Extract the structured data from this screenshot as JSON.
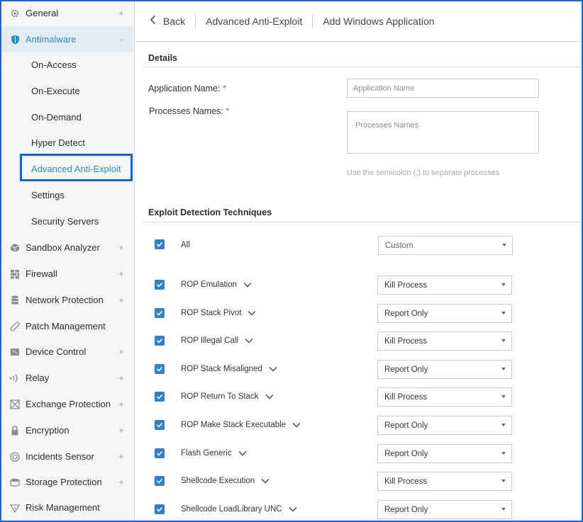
{
  "sidebar": {
    "items": [
      {
        "label": "General",
        "icon": "gear-icon",
        "expander": "+"
      },
      {
        "label": "Antimalware",
        "icon": "shield-icon",
        "expander": "-"
      },
      {
        "label": "Sandbox Analyzer",
        "icon": "cube-icon",
        "expander": "+"
      },
      {
        "label": "Firewall",
        "icon": "brick-wall-icon",
        "expander": "+"
      },
      {
        "label": "Network Protection",
        "icon": "database-icon",
        "expander": "+"
      },
      {
        "label": "Patch Management",
        "icon": "bandage-icon",
        "expander": ""
      },
      {
        "label": "Device Control",
        "icon": "device-icon",
        "expander": "+"
      },
      {
        "label": "Relay",
        "icon": "relay-icon",
        "expander": "+"
      },
      {
        "label": "Exchange Protection",
        "icon": "exchange-icon",
        "expander": "+"
      },
      {
        "label": "Encryption",
        "icon": "lock-icon",
        "expander": "+"
      },
      {
        "label": "Incidents Sensor",
        "icon": "sensor-icon",
        "expander": "+"
      },
      {
        "label": "Storage Protection",
        "icon": "storage-icon",
        "expander": "+"
      },
      {
        "label": "Risk Management",
        "icon": "risk-icon",
        "expander": ""
      }
    ],
    "antimalware_sub": [
      "On-Access",
      "On-Execute",
      "On-Demand",
      "Hyper Detect",
      "Advanced Anti-Exploit",
      "Settings",
      "Security Servers"
    ]
  },
  "topbar": {
    "back_label": "Back",
    "crumbs": [
      "Advanced Anti-Exploit",
      "Add Windows Application"
    ]
  },
  "details": {
    "title": "Details",
    "app_name_label": "Application Name:",
    "app_name_placeholder": "Application Name",
    "processes_label": "Processes Names:",
    "processes_placeholder": "Processes Names",
    "required_mark": "*",
    "hint": "Use the semicolon (;) to separate processes"
  },
  "exploit": {
    "title": "Exploit Detection Techniques",
    "all_label": "All",
    "all_value": "Custom",
    "techniques": [
      {
        "label": "ROP Emulation",
        "action": "Kill Process",
        "checked": true
      },
      {
        "label": "ROP Stack Pivot",
        "action": "Report Only",
        "checked": true
      },
      {
        "label": "ROP Illegal Call",
        "action": "Kill Process",
        "checked": true
      },
      {
        "label": "ROP Stack Misaligned",
        "action": "Report Only",
        "checked": true
      },
      {
        "label": "ROP Return To Stack",
        "action": "Kill Process",
        "checked": true
      },
      {
        "label": "ROP Make Stack Executable",
        "action": "Report Only",
        "checked": true
      },
      {
        "label": "Flash Generic",
        "action": "Report Only",
        "checked": true
      },
      {
        "label": "Shellcode Execution",
        "action": "Kill Process",
        "checked": true
      },
      {
        "label": "Shellcode LoadLibrary UNC",
        "action": "Report Only",
        "checked": true
      }
    ]
  },
  "colors": {
    "accent": "#2a8fbf",
    "checkbox": "#3080cf",
    "highlight_border": "#1565d8"
  }
}
